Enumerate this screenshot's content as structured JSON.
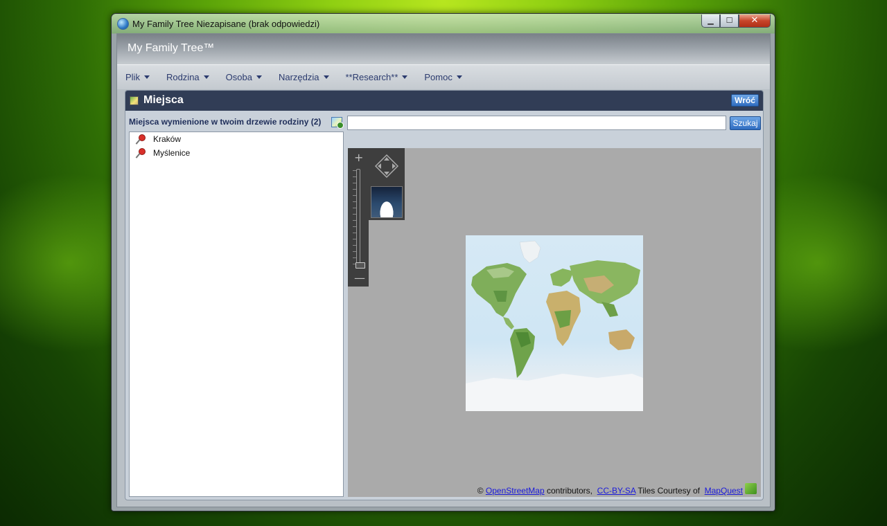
{
  "window": {
    "title": "My Family Tree Niezapisane (brak odpowiedzi)",
    "close_glyph": "✕",
    "min_glyph": "▁",
    "max_glyph": "☐"
  },
  "app": {
    "title": "My Family Tree™"
  },
  "menu": {
    "items": [
      {
        "label": "Plik"
      },
      {
        "label": "Rodzina"
      },
      {
        "label": "Osoba"
      },
      {
        "label": "Narzędzia"
      },
      {
        "label": "**Research**"
      },
      {
        "label": "Pomoc"
      }
    ]
  },
  "panel": {
    "title": "Miejsca",
    "back_label": "Wróć"
  },
  "places": {
    "heading": "Miejsca wymienione w twoim drzewie rodziny (2)",
    "items": [
      {
        "label": "Kraków"
      },
      {
        "label": "Myślenice"
      }
    ]
  },
  "search": {
    "value": "",
    "button_label": "Szukaj"
  },
  "map": {
    "zoom_plus": "+",
    "zoom_minus": "—",
    "attribution": {
      "copyright": "©",
      "osm_link": "OpenStreetMap",
      "contributors": "contributors,",
      "license_link": "CC-BY-SA",
      "tiles_text": "Tiles Courtesy of",
      "provider_link": "MapQuest"
    }
  },
  "icons": {
    "app": "family-tree-globe-icon",
    "panel": "map-icon",
    "place": "pushpin-icon",
    "add_map": "map-add-icon"
  },
  "colors": {
    "panel_header": "#313d56",
    "button_blue": "#2f6cc0",
    "menu_text": "#2b3b6e",
    "map_background": "#aaaaaa"
  }
}
